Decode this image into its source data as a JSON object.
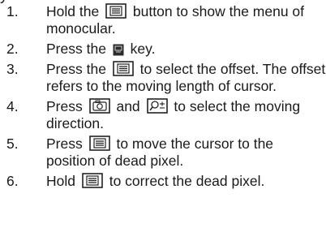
{
  "top_fragment": "y",
  "steps": [
    {
      "num": "1.",
      "parts": [
        "Hold the ",
        " button to show the menu of monocular."
      ]
    },
    {
      "num": "2.",
      "parts": [
        "Press the ",
        " key."
      ]
    },
    {
      "num": "3.",
      "parts": [
        "Press the ",
        " to select the offset. The offset refers to the moving length of cursor."
      ]
    },
    {
      "num": "4.",
      "parts": [
        "Press ",
        " and ",
        " to select the moving direction."
      ]
    },
    {
      "num": "5.",
      "parts": [
        "Press ",
        " to move the cursor to the position of dead pixel."
      ]
    },
    {
      "num": "6.",
      "parts": [
        "Hold ",
        " to correct the dead pixel."
      ]
    }
  ],
  "icons": {
    "menu": "menu-button-icon",
    "small_key": "small-key-icon",
    "camera": "camera-button-icon",
    "zoom": "zoom-button-icon"
  }
}
